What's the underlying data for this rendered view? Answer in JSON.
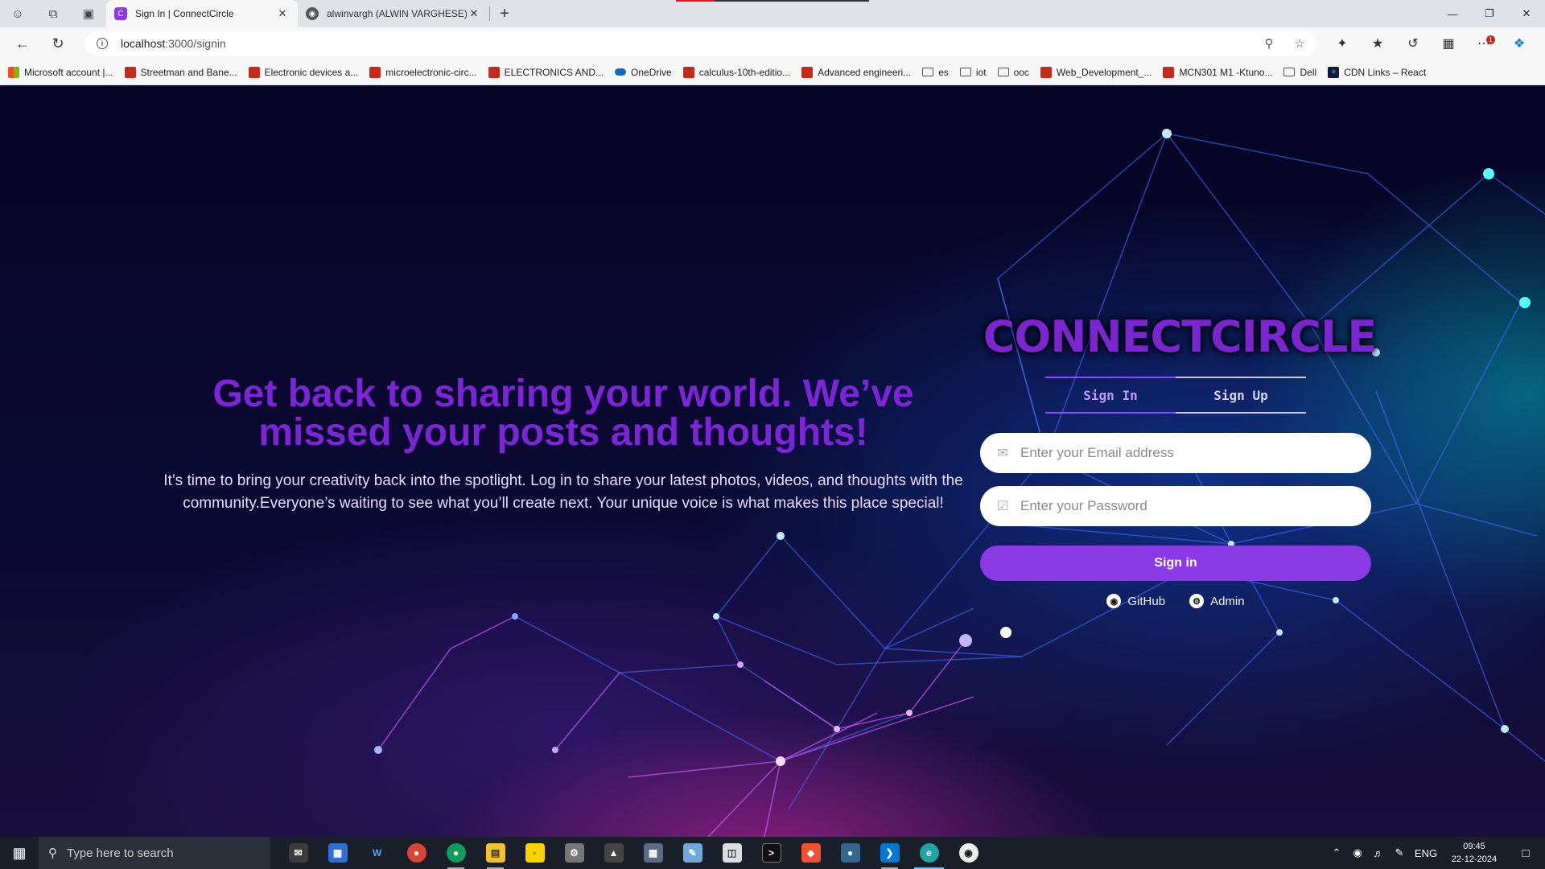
{
  "browser": {
    "tabs": [
      {
        "title": "Sign In | ConnectCircle",
        "active": true
      },
      {
        "title": "alwinvargh (ALWIN VARGHESE)",
        "active": false
      }
    ],
    "url_host": "localhost",
    "url_path": ":3000/signin",
    "bookmarks": [
      {
        "label": "Microsoft account |...",
        "icon": "microsoft-icon"
      },
      {
        "label": "Streetman and Bane...",
        "icon": "pdf-icon"
      },
      {
        "label": "Electronic devices a...",
        "icon": "pdf-icon"
      },
      {
        "label": "microelectronic-circ...",
        "icon": "pdf-icon"
      },
      {
        "label": "ELECTRONICS AND...",
        "icon": "pdf-icon"
      },
      {
        "label": "OneDrive",
        "icon": "onedrive-icon"
      },
      {
        "label": "calculus-10th-editio...",
        "icon": "pdf-icon"
      },
      {
        "label": "Advanced engineeri...",
        "icon": "pdf-icon"
      },
      {
        "label": "es",
        "icon": "folder-icon"
      },
      {
        "label": "iot",
        "icon": "folder-icon"
      },
      {
        "label": "ooc",
        "icon": "folder-icon"
      },
      {
        "label": "Web_Development_...",
        "icon": "pdf-icon"
      },
      {
        "label": "MCN301 M1 -Ktuno...",
        "icon": "pdf-icon"
      },
      {
        "label": "Dell",
        "icon": "folder-icon"
      },
      {
        "label": "CDN Links – React",
        "icon": "react-icon"
      }
    ],
    "extension_badge": "1"
  },
  "hero": {
    "heading": "Get back to sharing your world. We’ve missed your posts and thoughts!",
    "body": "It’s time to bring your creativity back into the spotlight. Log in to share your latest photos, videos, and thoughts with the community.Everyone’s waiting to see what you’ll create next. Your unique voice is what makes this place special!"
  },
  "auth": {
    "logo": "CONNECTCIRCLE",
    "tab_signin": "Sign In",
    "tab_signup": "Sign Up",
    "email_placeholder": "Enter your Email address",
    "password_placeholder": "Enter your Password",
    "submit_label": "Sign in",
    "github_label": "GitHub",
    "admin_label": "Admin"
  },
  "taskbar": {
    "search_placeholder": "Type here to search",
    "language": "ENG",
    "time": "09:45",
    "date": "22-12-2024"
  },
  "colors": {
    "accent": "#8b3ae6",
    "heading": "#7b25d6"
  }
}
